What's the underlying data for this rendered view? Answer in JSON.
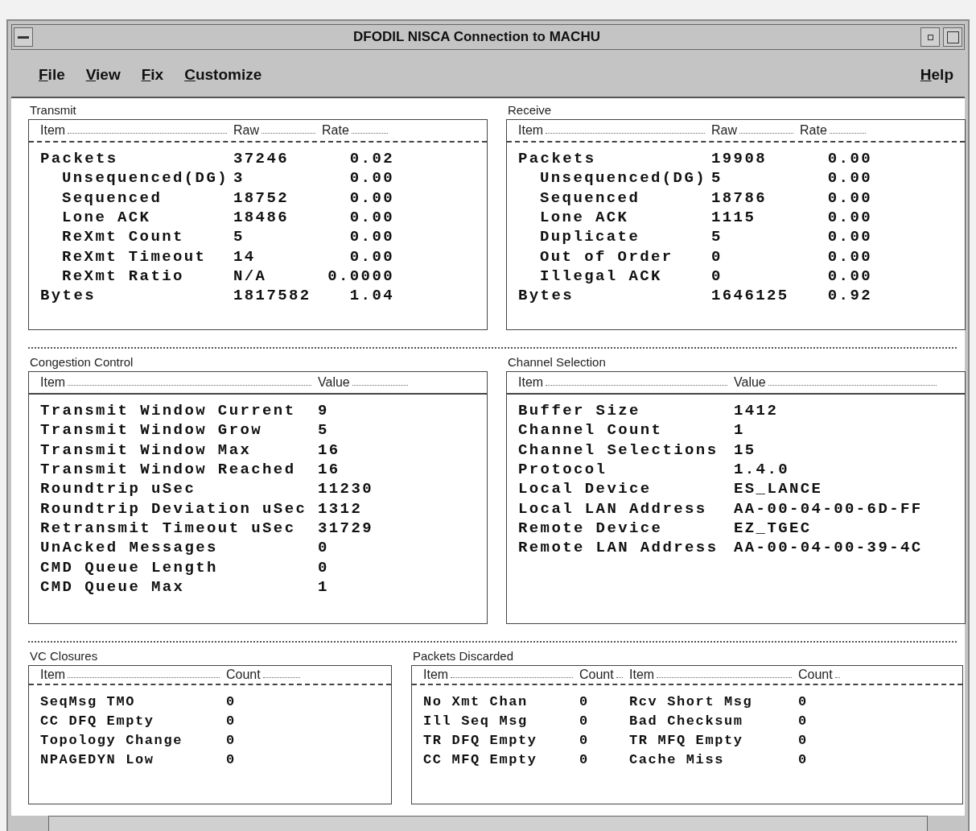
{
  "window": {
    "title": "DFODIL NISCA Connection to MACHU"
  },
  "menu": {
    "left": [
      "File",
      "View",
      "Fix",
      "Customize"
    ],
    "right": [
      "Help"
    ]
  },
  "panels": [
    {
      "title": "Transmit",
      "columns": [
        "Item",
        "Raw",
        "Rate"
      ],
      "rows": [
        {
          "cells": [
            "Packets",
            "37246",
            "0.02"
          ],
          "children": [
            {
              "cells": [
                "Unsequenced(DG)",
                "3",
                "0.00"
              ]
            },
            {
              "cells": [
                "Sequenced",
                "18752",
                "0.00"
              ]
            },
            {
              "cells": [
                "Lone ACK",
                "18486",
                "0.00"
              ]
            },
            {
              "cells": [
                "ReXmt Count",
                "5",
                "0.00"
              ]
            },
            {
              "cells": [
                "ReXmt Timeout",
                "14",
                "0.00"
              ]
            },
            {
              "cells": [
                "ReXmt Ratio",
                "N/A",
                "0.0000"
              ]
            }
          ]
        },
        {
          "cells": [
            "Bytes",
            "1817582",
            "1.04"
          ]
        }
      ]
    },
    {
      "title": "Receive",
      "columns": [
        "Item",
        "Raw",
        "Rate"
      ],
      "rows": [
        {
          "cells": [
            "Packets",
            "19908",
            "0.00"
          ],
          "children": [
            {
              "cells": [
                "Unsequenced(DG)",
                "5",
                "0.00"
              ]
            },
            {
              "cells": [
                "Sequenced",
                "18786",
                "0.00"
              ]
            },
            {
              "cells": [
                "Lone ACK",
                "1115",
                "0.00"
              ]
            },
            {
              "cells": [
                "Duplicate",
                "5",
                "0.00"
              ]
            },
            {
              "cells": [
                "Out of Order",
                "0",
                "0.00"
              ]
            },
            {
              "cells": [
                "Illegal ACK",
                "0",
                "0.00"
              ]
            }
          ]
        },
        {
          "cells": [
            "Bytes",
            "1646125",
            "0.92"
          ]
        }
      ]
    },
    {
      "title": "Congestion Control",
      "columns": [
        "Item",
        "Value"
      ],
      "rows": [
        {
          "cells": [
            "Transmit Window Current",
            "9"
          ]
        },
        {
          "cells": [
            "Transmit Window Grow",
            "5"
          ]
        },
        {
          "cells": [
            "Transmit Window Max",
            "16"
          ]
        },
        {
          "cells": [
            "Transmit Window Reached",
            "16"
          ]
        },
        {
          "cells": [
            "Roundtrip uSec",
            "11230"
          ]
        },
        {
          "cells": [
            "Roundtrip Deviation uSec",
            "1312"
          ]
        },
        {
          "cells": [
            "Retransmit Timeout uSec",
            "31729"
          ]
        },
        {
          "cells": [
            "UnAcked Messages",
            "0"
          ]
        },
        {
          "cells": [
            "CMD Queue Length",
            "0"
          ]
        },
        {
          "cells": [
            "CMD Queue Max",
            "1"
          ]
        }
      ]
    },
    {
      "title": "Channel Selection",
      "columns": [
        "Item",
        "Value"
      ],
      "rows": [
        {
          "cells": [
            "Buffer Size",
            "1412"
          ]
        },
        {
          "cells": [
            "Channel Count",
            "1"
          ]
        },
        {
          "cells": [
            "Channel Selections",
            "15"
          ]
        },
        {
          "cells": [
            "Protocol",
            "1.4.0"
          ]
        },
        {
          "cells": [
            "Local Device",
            "ES_LANCE"
          ]
        },
        {
          "cells": [
            "Local LAN Address",
            "AA-00-04-00-6D-FF"
          ]
        },
        {
          "cells": [
            "Remote Device",
            "EZ_TGEC"
          ]
        },
        {
          "cells": [
            "Remote LAN Address",
            "AA-00-04-00-39-4C"
          ]
        }
      ]
    },
    {
      "title": "VC Closures",
      "columns": [
        "Item",
        "Count"
      ],
      "rows": [
        {
          "cells": [
            "SeqMsg TMO",
            "0"
          ]
        },
        {
          "cells": [
            "CC DFQ Empty",
            "0"
          ]
        },
        {
          "cells": [
            "Topology Change",
            "0"
          ]
        },
        {
          "cells": [
            "NPAGEDYN Low",
            "0"
          ]
        }
      ]
    },
    {
      "title": "Packets Discarded",
      "columns": [
        "Item",
        "Count",
        "Item",
        "Count"
      ],
      "rows": [
        {
          "cells": [
            "No Xmt Chan",
            "0",
            "Rcv Short Msg",
            "0"
          ]
        },
        {
          "cells": [
            "Ill Seq Msg",
            "0",
            "Bad Checksum",
            "0"
          ]
        },
        {
          "cells": [
            "TR DFQ Empty",
            "0",
            "TR MFQ Empty",
            "0"
          ]
        },
        {
          "cells": [
            "CC MFQ Empty",
            "0",
            "Cache Miss",
            "0"
          ]
        }
      ]
    }
  ]
}
